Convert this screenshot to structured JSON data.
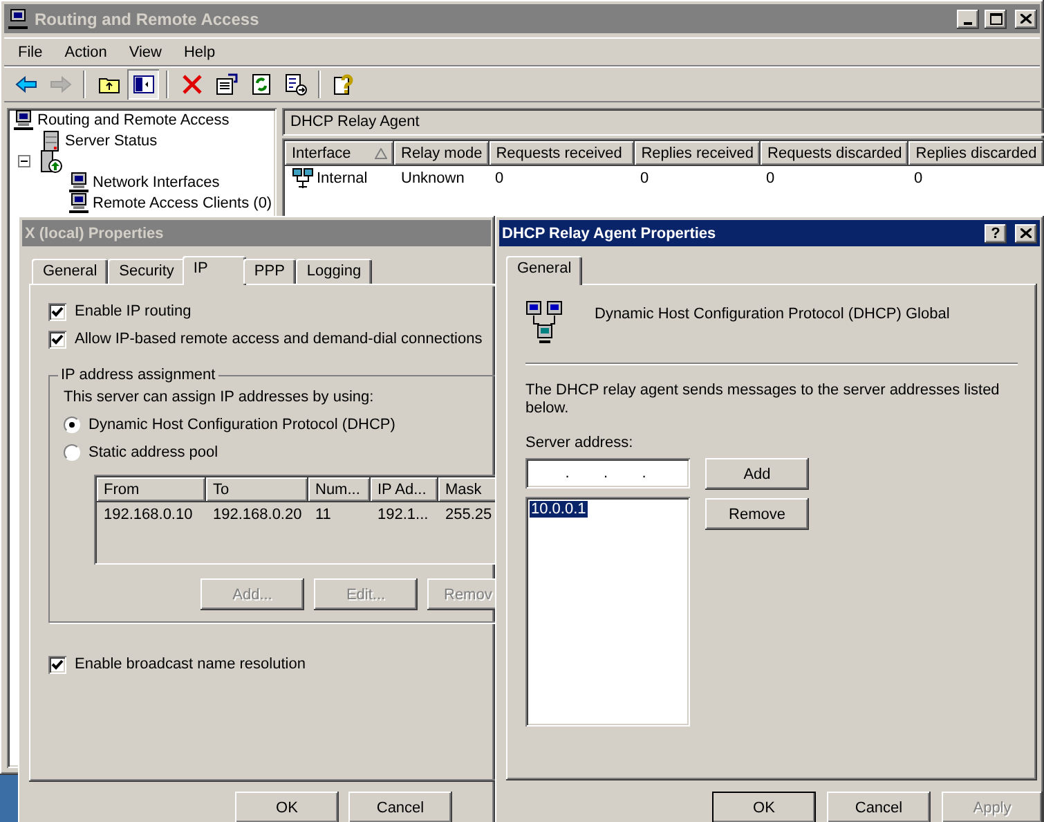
{
  "main_window": {
    "title": "Routing and Remote Access",
    "active": false,
    "menu": [
      "File",
      "Action",
      "View",
      "Help"
    ],
    "toolbar": [
      {
        "kind": "back",
        "disabled": false,
        "pressed": false
      },
      {
        "kind": "forward",
        "disabled": true,
        "pressed": false
      },
      {
        "kind": "separator"
      },
      {
        "kind": "up",
        "disabled": false,
        "pressed": false
      },
      {
        "kind": "tree",
        "disabled": false,
        "pressed": true
      },
      {
        "kind": "separator"
      },
      {
        "kind": "delete",
        "disabled": false,
        "pressed": false
      },
      {
        "kind": "properties",
        "disabled": false,
        "pressed": false
      },
      {
        "kind": "refresh",
        "disabled": false,
        "pressed": false
      },
      {
        "kind": "export",
        "disabled": false,
        "pressed": false
      },
      {
        "kind": "separator"
      },
      {
        "kind": "help",
        "disabled": false,
        "pressed": false
      }
    ],
    "tree": [
      {
        "label": "Routing and Remote Access",
        "kind": "computer",
        "children": [
          {
            "label": "Server Status",
            "kind": "status"
          },
          {
            "kind": "server",
            "expanded": true,
            "children": [
              {
                "label": "Network Interfaces",
                "kind": "computer"
              },
              {
                "label": "Remote Access Clients (0)",
                "kind": "computer"
              }
            ]
          }
        ]
      }
    ],
    "pane_title": "DHCP Relay Agent",
    "table": {
      "columns": [
        {
          "label": "Interface",
          "sorted": true
        },
        {
          "label": "Relay mode",
          "sorted": false
        },
        {
          "label": "Requests received",
          "sorted": false
        },
        {
          "label": "Replies received",
          "sorted": false
        },
        {
          "label": "Requests discarded",
          "sorted": false
        },
        {
          "label": "Replies discarded",
          "sorted": false
        }
      ],
      "rows": [
        {
          "cells": [
            "Internal",
            "Unknown",
            "0",
            "0",
            "0",
            "0"
          ]
        }
      ]
    }
  },
  "props_window": {
    "title": "X (local) Properties",
    "active": false,
    "tabs": [
      {
        "label": "General",
        "selected": false
      },
      {
        "label": "Security",
        "selected": false
      },
      {
        "label": "IP",
        "selected": true
      },
      {
        "label": "PPP",
        "selected": false
      },
      {
        "label": "Logging",
        "selected": false
      }
    ],
    "checkboxes": [
      {
        "label": "Enable IP routing",
        "checked": true
      },
      {
        "label": "Allow IP-based remote access and demand-dial connections",
        "checked": true
      }
    ],
    "group": {
      "title": "IP address assignment",
      "intro": "This server can assign IP addresses by using:",
      "options": [
        {
          "label": "Dynamic Host Configuration Protocol (DHCP)",
          "selected": true
        },
        {
          "label": "Static address pool",
          "selected": false
        }
      ],
      "pool": {
        "columns": [
          "From",
          "To",
          "Num...",
          "IP Ad...",
          "Mask"
        ],
        "rows": [
          [
            "192.168.0.10",
            "192.168.0.20",
            "11",
            "192.1...",
            "255.25"
          ]
        ]
      },
      "buttons": [
        {
          "label": "Add...",
          "disabled": true
        },
        {
          "label": "Edit...",
          "disabled": true
        },
        {
          "label": "Remov",
          "disabled": true
        }
      ]
    },
    "broadcast": {
      "label": "Enable broadcast name resolution",
      "checked": true
    },
    "buttons": [
      {
        "label": "OK",
        "disabled": false
      },
      {
        "label": "Cancel",
        "disabled": false
      }
    ]
  },
  "dhcp_window": {
    "title": "DHCP Relay Agent Properties",
    "active": true,
    "help_button": "?",
    "tabs": [
      {
        "label": "General",
        "selected": true
      }
    ],
    "heading": "Dynamic Host Configuration Protocol (DHCP) Global",
    "description": "The DHCP relay agent sends messages to the server addresses listed below.",
    "address_label": "Server address:",
    "address_field": {
      "separator": "."
    },
    "servers": [
      {
        "address": "10.0.0.1",
        "selected": true
      }
    ],
    "side_buttons": [
      {
        "label": "Add",
        "disabled": false
      },
      {
        "label": "Remove",
        "disabled": false
      }
    ],
    "buttons": [
      {
        "label": "OK",
        "disabled": false,
        "default": true
      },
      {
        "label": "Cancel",
        "disabled": false,
        "default": false
      },
      {
        "label": "Apply",
        "disabled": true,
        "default": false
      }
    ]
  }
}
